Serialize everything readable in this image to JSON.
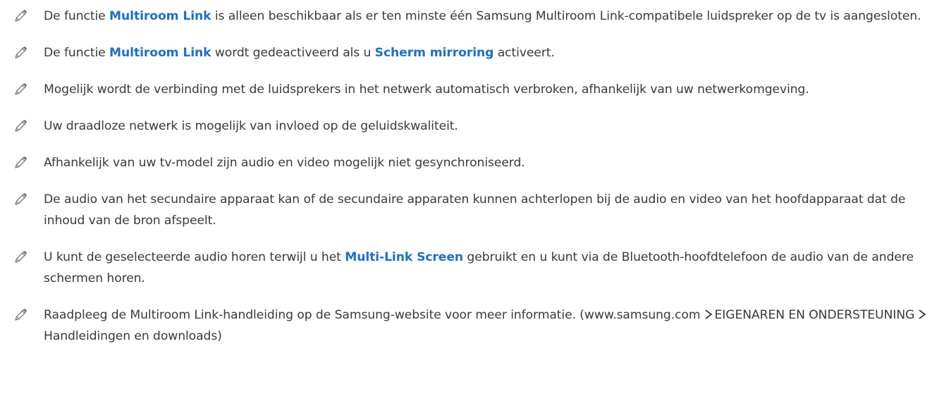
{
  "icon": "pencil-note-icon",
  "colors": {
    "text": "#3a3a3a",
    "keyword": "#1e6fc9",
    "icon": "#7a7a7a"
  },
  "notes": [
    {
      "before": "De functie ",
      "keyword": "Multiroom Link",
      "after": " is alleen beschikbaar als er ten minste één Samsung Multiroom Link-compatibele luidspreker op de tv is aangesloten."
    },
    {
      "before": "De functie ",
      "keyword": "Multiroom Link",
      "middle": " wordt gedeactiveerd als u ",
      "keyword2": "Scherm mirroring",
      "after": " activeert."
    },
    {
      "text": "Mogelijk wordt de verbinding met de luidsprekers in het netwerk automatisch verbroken, afhankelijk van uw netwerkomgeving."
    },
    {
      "text": "Uw draadloze netwerk is mogelijk van invloed op de geluidskwaliteit."
    },
    {
      "text": "Afhankelijk van uw tv-model zijn audio en video mogelijk niet gesynchroniseerd."
    },
    {
      "text": "De audio van het secundaire apparaat kan of de secundaire apparaten kunnen achterlopen bij de audio en video van het hoofdapparaat dat de inhoud van de bron afspeelt."
    },
    {
      "before": "U kunt de geselecteerde audio horen terwijl u het ",
      "keyword": "Multi-Link Screen",
      "after": " gebruikt en u kunt via de Bluetooth-hoofdtelefoon de audio van de andere schermen horen."
    },
    {
      "part1": "Raadpleeg de Multiroom Link-handleiding op de Samsung-website voor meer informatie. (www.samsung.com",
      "part2": "EIGENAREN EN ONDERSTEUNING",
      "part3": "Handleidingen en downloads)"
    }
  ]
}
